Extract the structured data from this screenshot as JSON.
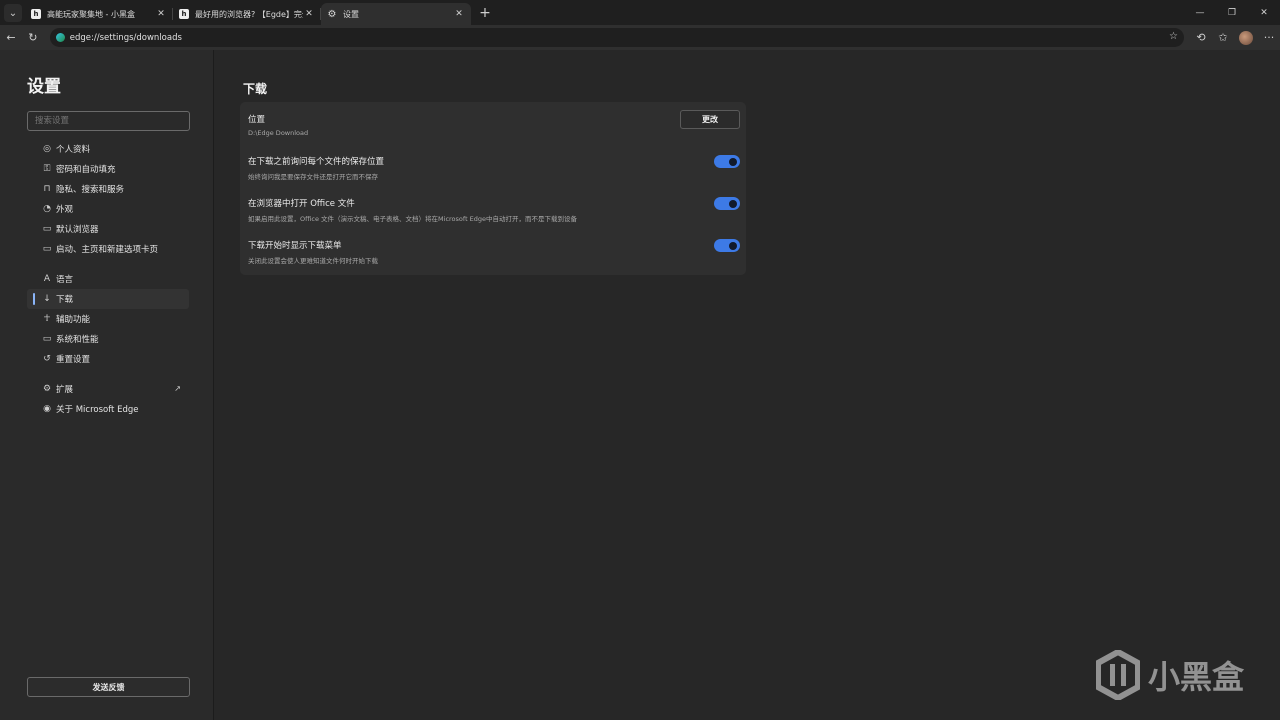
{
  "browser": {
    "tabs": [
      {
        "title": "高能玩家聚集地 - 小黑盒",
        "favicon": "heybox-icon",
        "active": false
      },
      {
        "title": "最好用的浏览器? 【Egde】完全体",
        "favicon": "heybox-icon",
        "active": false
      },
      {
        "title": "设置",
        "favicon": "gear-icon",
        "active": true
      }
    ],
    "url": "edge://settings/downloads"
  },
  "sidebar": {
    "title": "设置",
    "search_placeholder": "搜索设置",
    "items": [
      {
        "label": "个人资料",
        "icon": "profile-icon"
      },
      {
        "label": "密码和自动填充",
        "icon": "key-icon"
      },
      {
        "label": "隐私、搜索和服务",
        "icon": "lock-icon"
      },
      {
        "label": "外观",
        "icon": "appearance-icon"
      },
      {
        "label": "默认浏览器",
        "icon": "browser-icon"
      },
      {
        "label": "启动、主页和新建选项卡页",
        "icon": "home-icon"
      },
      {
        "label": "语言",
        "icon": "language-icon"
      },
      {
        "label": "下载",
        "icon": "download-icon",
        "active": true
      },
      {
        "label": "辅助功能",
        "icon": "accessibility-icon"
      },
      {
        "label": "系统和性能",
        "icon": "laptop-icon"
      },
      {
        "label": "重置设置",
        "icon": "reset-icon"
      },
      {
        "label": "扩展",
        "icon": "extensions-icon"
      },
      {
        "label": "关于 Microsoft Edge",
        "icon": "edge-icon"
      }
    ],
    "feedback_label": "发送反馈"
  },
  "main": {
    "title": "下载",
    "location": {
      "label": "位置",
      "path": "D:\\Edge Download",
      "button": "更改"
    },
    "settings": [
      {
        "label": "在下载之前询问每个文件的保存位置",
        "desc": "始终询问我是要保存文件还是打开它而不保存",
        "enabled": true
      },
      {
        "label": "在浏览器中打开 Office 文件",
        "desc": "如果启用此设置，Office 文件（演示文稿、电子表格、文档）将在Microsoft Edge中自动打开，而不是下载到设备",
        "enabled": true
      },
      {
        "label": "下载开始时显示下载菜单",
        "desc": "关闭此设置会使人更难知道文件何时开始下载",
        "enabled": true
      }
    ]
  },
  "watermark": {
    "text": "小黑盒"
  },
  "colors": {
    "accent": "#3d7ae6",
    "background": "#272727",
    "sidebar": "#2a2a2a",
    "card": "#2f2f2f"
  }
}
